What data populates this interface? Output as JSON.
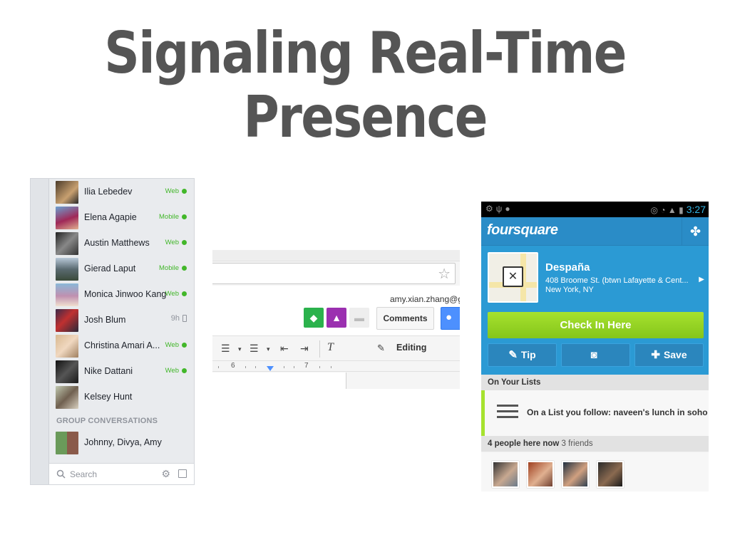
{
  "slide": {
    "title_line1": "Signaling Real-Time",
    "title_line2": "Presence"
  },
  "facebook_chat": {
    "contacts": [
      {
        "name": "Ilia Lebedev",
        "status": "Web",
        "online": true
      },
      {
        "name": "Elena Agapie",
        "status": "Mobile",
        "online": true
      },
      {
        "name": "Austin Matthews",
        "status": "Web",
        "online": true
      },
      {
        "name": "Gierad Laput",
        "status": "Mobile",
        "online": true
      },
      {
        "name": "Monica Jinwoo Kang",
        "status": "Web",
        "online": true
      },
      {
        "name": "Josh Blum",
        "status": "9h",
        "online": false
      },
      {
        "name": "Christina Amari A...",
        "status": "Web",
        "online": true
      },
      {
        "name": "Nike Dattani",
        "status": "Web",
        "online": true
      },
      {
        "name": "Kelsey Hunt",
        "status": "",
        "online": false
      }
    ],
    "group_header": "GROUP CONVERSATIONS",
    "group_name": "Johnny, Divya, Amy",
    "search_placeholder": "Search",
    "colors": {
      "online": "#42b72a",
      "text": "#1d2129",
      "muted": "#90949c"
    }
  },
  "google_docs": {
    "account_email": "amy.xian.zhang@g",
    "comments_label": "Comments",
    "editing_label": "Editing",
    "ruler_numbers": [
      "6",
      "7"
    ],
    "colors": {
      "share": "#4d90fe",
      "collab_green": "#2bb24c",
      "collab_purple": "#9b30b0"
    }
  },
  "foursquare": {
    "status_time": "3:27",
    "logo": "foursquare",
    "venue_name": "Despaña",
    "address_line1": "408 Broome St. (btwn Lafayette & Cent...",
    "address_line2": "New York, NY",
    "checkin_label": "Check In Here",
    "actions": [
      "Tip",
      "",
      "Save"
    ],
    "on_lists_header": "On Your Lists",
    "list_item": "On a List you follow: naveen's lunch in soho",
    "people_here": "4 people here now",
    "friends_count": "3 friends",
    "colors": {
      "brand_blue": "#2b9ad4",
      "checkin_green": "#a6e22e"
    }
  }
}
